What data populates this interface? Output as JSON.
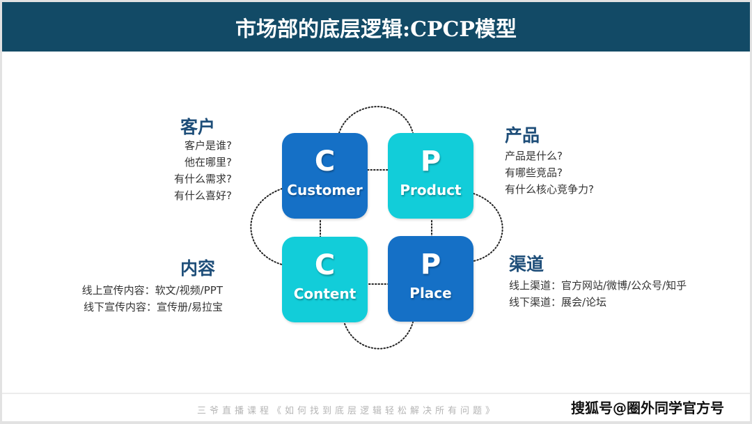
{
  "header": {
    "title": "市场部的底层逻辑:CPCP模型"
  },
  "colors": {
    "header_bg": "#124a66",
    "box_dark": "#1570c6",
    "box_light": "#12cdd9",
    "section_title": "#1e4e79"
  },
  "boxes": [
    {
      "letter": "C",
      "word": "Customer",
      "style": "dark"
    },
    {
      "letter": "P",
      "word": "Product",
      "style": "light"
    },
    {
      "letter": "C",
      "word": "Content",
      "style": "light"
    },
    {
      "letter": "P",
      "word": "Place",
      "style": "dark"
    }
  ],
  "sections": {
    "customer": {
      "title": "客户",
      "lines": [
        "客户是谁?",
        "他在哪里?",
        "有什么需求?",
        "有什么喜好?"
      ]
    },
    "product": {
      "title": "产品",
      "lines": [
        "产品是什么?",
        "有哪些竞品?",
        "有什么核心竞争力?"
      ]
    },
    "content": {
      "title": "内容",
      "lines": [
        "线上宣传内容：软文/视频/PPT",
        "线下宣传内容：宣传册/易拉宝"
      ]
    },
    "place": {
      "title": "渠道",
      "lines": [
        "线上渠道：官方网站/微博/公众号/知乎",
        "线下渠道：展会/论坛"
      ]
    }
  },
  "footer": {
    "course": "三爷直播课程《如何找到底层逻辑轻松解决所有问题》",
    "watermark": "搜狐号@圈外同学官方号"
  }
}
